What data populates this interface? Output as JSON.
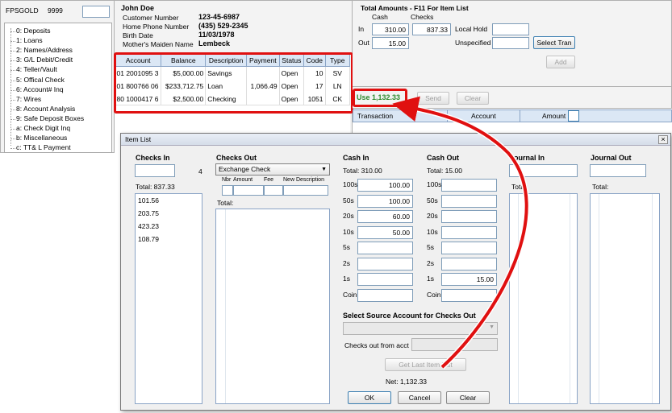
{
  "main_window": {
    "app_name": "FPSGOLD",
    "branch": "9999",
    "menu": [
      "0: Deposits",
      "1: Loans",
      "2: Names/Address",
      "3: G/L Debit/Credit",
      "4: Teller/Vault",
      "5: Offical Check",
      "6: Account# Inq",
      "7: Wires",
      "8: Account Analysis",
      "9: Safe Deposit Boxes",
      "a: Check Digit Inq",
      "b: Miscellaneous",
      "c: TT& L Payment"
    ],
    "customer": {
      "name": "John Doe",
      "fields": [
        {
          "label": "Customer Number",
          "value": "123-45-6987"
        },
        {
          "label": "Home Phone Number",
          "value": "(435) 529-2345"
        },
        {
          "label": "Birth Date",
          "value": "11/03/1978"
        },
        {
          "label": "Mother's Maiden Name",
          "value": "Lembeck"
        }
      ]
    },
    "accounts": {
      "headers": [
        "Account",
        "Balance",
        "Description",
        "Payment",
        "Status",
        "Code",
        "Type"
      ],
      "rows": [
        [
          "01 2001095 3",
          "$5,000.00",
          "Savings",
          "",
          "Open",
          "10",
          "SV"
        ],
        [
          "01 800766 06",
          "$233,712.75",
          "Loan",
          "1,066.49",
          "Open",
          "17",
          "LN"
        ],
        [
          "80 1000417 6",
          "$2,500.00",
          "Checking",
          "",
          "Open",
          "1051",
          "CK"
        ]
      ]
    },
    "totals": {
      "title": "Total Amounts - F11 For Item List",
      "cash_label": "Cash",
      "checks_label": "Checks",
      "in_label": "In",
      "out_label": "Out",
      "in_cash": "310.00",
      "in_checks": "837.33",
      "out_cash": "15.00",
      "local_hold_label": "Local Hold",
      "unspecified_label": "Unspecified",
      "select_tran_label": "Select Tran",
      "add_label": "Add"
    },
    "use_text": "Use 1,132.33",
    "send_label": "Send",
    "clear_label": "Clear",
    "tran_headers": [
      "Transaction",
      "Account",
      "Amount"
    ]
  },
  "item_list": {
    "title": "Item List",
    "close_glyph": "×",
    "checks_in": {
      "heading": "Checks In",
      "count": "4",
      "total": "Total: 837.33",
      "items": [
        "101.56",
        "203.75",
        "423.23",
        "108.79"
      ]
    },
    "checks_out": {
      "heading": "Checks Out",
      "type": "Exchange Check",
      "cols": [
        "Nbr",
        "Amount",
        "Fee",
        "New Description"
      ],
      "total": "Total:"
    },
    "cash_in": {
      "heading": "Cash In",
      "total": "Total: 310.00",
      "values": [
        "100.00",
        "100.00",
        "60.00",
        "50.00",
        "",
        "",
        "",
        ""
      ]
    },
    "cash_out": {
      "heading": "Cash Out",
      "total": "Total: 15.00",
      "values": [
        "",
        "",
        "",
        "",
        "",
        "",
        "15.00",
        ""
      ]
    },
    "denoms": [
      "100s",
      "50s",
      "20s",
      "10s",
      "5s",
      "2s",
      "1s",
      "Coin"
    ],
    "journal_in": {
      "heading": "Journal In",
      "total": "Total:"
    },
    "journal_out": {
      "heading": "Journal Out",
      "total": "Total:"
    },
    "select_source": "Select Source Account for Checks Out",
    "checks_from_acct": "Checks out from acct",
    "get_last_label": "Get Last Item List",
    "net": "Net: 1,132.33",
    "ok_label": "OK",
    "cancel_label": "Cancel",
    "clear_label": "Clear"
  },
  "colors": {
    "highlight": "#e01010",
    "use_green": "#2e8b2e",
    "header_blue": "#dbe7f5"
  }
}
